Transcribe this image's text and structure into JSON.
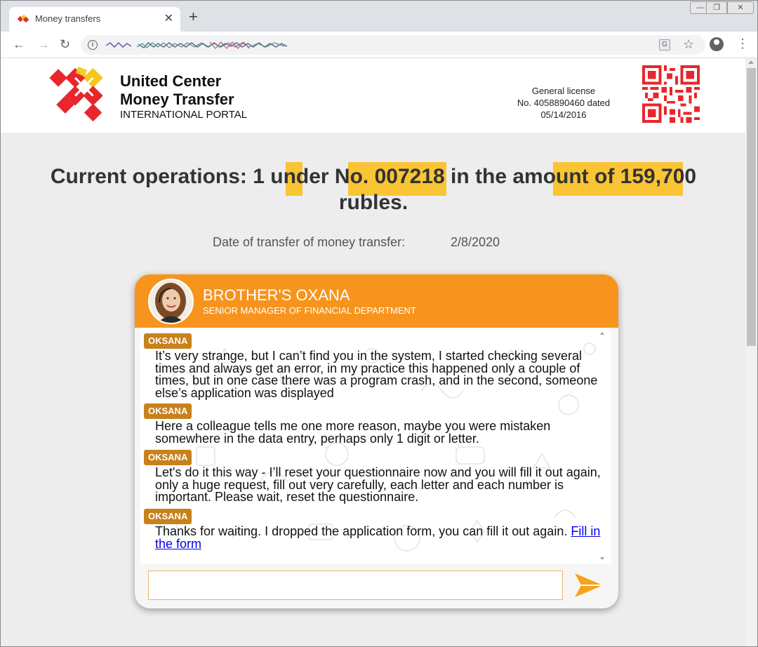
{
  "browser": {
    "tab_title": "Money transfers",
    "tab_close": "✕",
    "new_tab": "+",
    "win_min": "—",
    "win_max": "❐",
    "win_close": "✕",
    "nav_back": "←",
    "nav_forward": "→",
    "nav_reload": "↻",
    "translate": "G",
    "star": "☆",
    "menu": "⋮",
    "icons": [
      "favicon-icon",
      "info-icon",
      "translate-icon",
      "star-icon",
      "profile-icon",
      "menu-icon"
    ]
  },
  "site": {
    "brand_line1": "United Center",
    "brand_line2": "Money Transfer",
    "brand_line3": "INTERNATIONAL PORTAL",
    "license_line1": "General license",
    "license_line2": "No. 4058890460 dated",
    "license_line3": "05/14/2016"
  },
  "operation": {
    "headline": "Current operations: 1 under No. 007218 in the amount of 159,700 rubles.",
    "date_label": "Date of transfer of money transfer:",
    "date_value": "2/8/2020"
  },
  "chat": {
    "agent_name": "BROTHER'S OXANA",
    "agent_role": "SENIOR MANAGER OF FINANCIAL DEPARTMENT",
    "messages": [
      {
        "sender": "OKSANA",
        "text": "It’s very strange, but I can’t find you in the system, I started checking several times and always get an error, in my practice this happened only a couple of times, but in one case there was a program crash, and in the second, someone else’s application was displayed"
      },
      {
        "sender": "OKSANA",
        "text": "Here a colleague tells me one more reason, maybe you were mistaken somewhere in the data entry, perhaps only 1 digit or letter."
      },
      {
        "sender": "OKSANA",
        "text": "Let's do it this way - I’ll reset your questionnaire now and you will fill it out again, only a huge request, fill out very carefully, each letter and each number is important. Please wait, reset the questionnaire."
      },
      {
        "sender": "OKSANA",
        "text": "Thanks for waiting. I dropped the application form, you can fill it out again. ",
        "link": "Fill in the form"
      }
    ],
    "input_value": "",
    "send_icon": "send-arrow-icon"
  },
  "colors": {
    "accent_orange": "#f7941d",
    "highlight_yellow": "#f9c534",
    "sender_badge": "#c8811b",
    "logo_red": "#e8262b",
    "logo_yellow": "#f7c51b"
  }
}
